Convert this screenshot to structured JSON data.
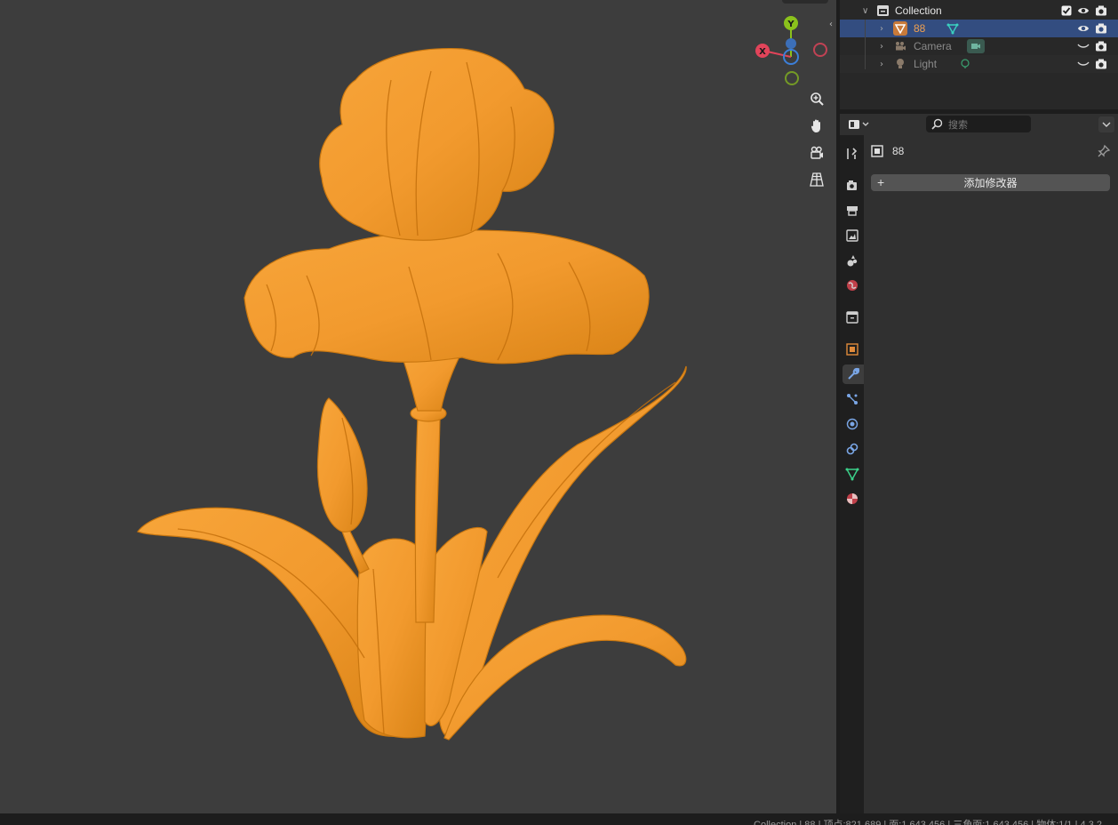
{
  "outliner": {
    "collection": {
      "label": "Collection"
    },
    "objects": [
      {
        "label": "88",
        "type": "mesh"
      },
      {
        "label": "Camera",
        "type": "camera"
      },
      {
        "label": "Light",
        "type": "light"
      }
    ]
  },
  "gizmo": {
    "y": "Y",
    "x": "X"
  },
  "properties": {
    "search_placeholder": "搜索",
    "object_name": "88",
    "add_modifier_label": "添加修改器",
    "add_modifier_plus": "+"
  },
  "statusbar": {
    "text": "Collection | 88 | 顶点:821,689 | 面:1,643,456 | 三角面:1,643,456 | 物体:1/1 | 4.3.2"
  },
  "colors": {
    "model": "#f29a2e",
    "viewport_bg": "#3d3d3d",
    "selection": "#334d80",
    "axis_x": "#e2445a",
    "axis_y": "#8bc21c",
    "axis_z": "#3c7fd8"
  }
}
